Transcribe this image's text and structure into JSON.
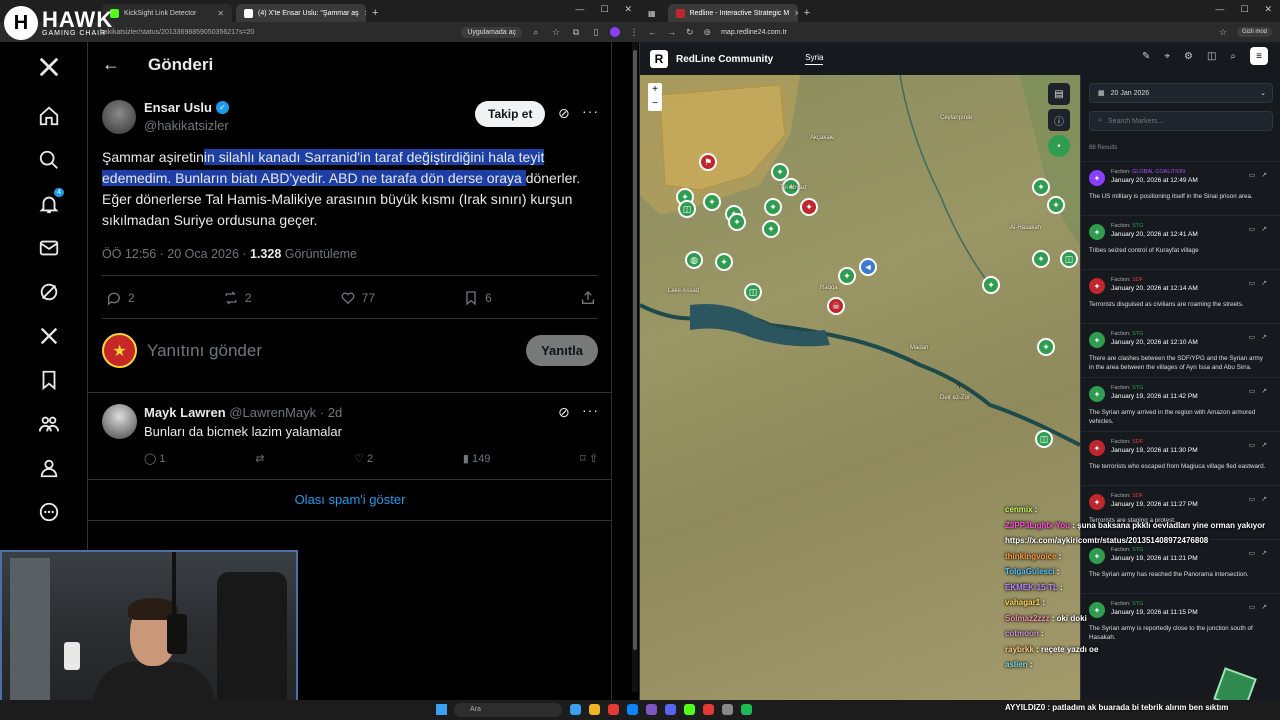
{
  "left_browser": {
    "tabs": [
      {
        "title": "KickSight Link Detector",
        "active": false,
        "color": "#53fc18"
      },
      {
        "title": "(4) X'te Ensar Uslu: \"Şammar aş",
        "active": true,
        "color": "#ffffff"
      }
    ],
    "url": "hakikatsizler/status/20133698859050356217s=20",
    "app_pill": "Uygulamada aç"
  },
  "overlay_logo": {
    "mark": "H",
    "name": "HAWK",
    "sub": "GAMING CHAIR"
  },
  "x_sidebar": {
    "items": [
      "x-logo",
      "home",
      "search",
      "notifications",
      "messages",
      "grok",
      "x-premium",
      "bookmarks",
      "communities",
      "profile",
      "more"
    ],
    "notification_count": "4"
  },
  "x_main": {
    "header": {
      "title": "Gönderi"
    },
    "tweet": {
      "author_name": "Ensar Uslu",
      "author_handle": "@hakikatsizler",
      "follow_label": "Takip et",
      "text_plain_start": "Şammar aşiretin",
      "text_highlighted": "in silahlı kanadı Sarranid'in taraf değiştirdiğini hala teyit edemedim. Bunların biatı ABD'yedir. ABD ne tarafa dön derse oraya ",
      "text_plain_end": "dönerler. Eğer dönerlerse Tal Hamis-Malikiye arasının büyük kısmı (Irak sınırı) kurşun sıkılmadan Suriye ordusuna geçer.",
      "meta_time": "ÖÖ 12:56 · 20 Oca 2026 · ",
      "meta_views": "1.328",
      "meta_views_label": " Görüntüleme",
      "stats": {
        "replies": "2",
        "reposts": "2",
        "likes": "77",
        "bookmarks": "6"
      }
    },
    "reply_placeholder": "Yanıtını gönder",
    "reply_button": "Yanıtla",
    "reply": {
      "name": "Mayk Lawren",
      "handle": "@LawrenMayk · 2d",
      "text": "Bunları da bicmek lazim yalamalar",
      "replies": "1",
      "likes": "2",
      "views": "149"
    },
    "spam_link": "Olası spam'i göster"
  },
  "right_browser": {
    "tab_title": "Redline - Interactive Strategic M",
    "url": "map.redline24.com.tr",
    "incognito": "Gizli mod"
  },
  "redline": {
    "brand": "RedLine Community",
    "region_tab": "Syria",
    "date": "20 Jan 2026",
    "search_placeholder": "Search Markers...",
    "results": "88 Results",
    "feed": [
      {
        "faction": "GLOBAL COALITION",
        "faction_color": "#b04cff",
        "date": "January 20, 2026 at 12:49 AM",
        "text": "The US military is positioning itself in the Sinai prison area.",
        "icon_color": "#8a3ffc"
      },
      {
        "faction": "STG",
        "faction_color": "#2e9d4f",
        "date": "January 20, 2026 at 12:41 AM",
        "text": "Tribes seized control of Kurayfat village",
        "icon_color": "#2e9d4f"
      },
      {
        "faction": "SDF",
        "faction_color": "#e53935",
        "date": "January 20, 2026 at 12:14 AM",
        "text": "Terrorists disguised as civilians are roaming the streets.",
        "icon_color": "#c0262d"
      },
      {
        "faction": "STG",
        "faction_color": "#2e9d4f",
        "date": "January 20, 2026 at 12:10 AM",
        "text": "There are clashes between the SDF/YPG and the Syrian army in the area between the villages of Ayn Issa and Abu Sirra.",
        "icon_color": "#2e9d4f"
      },
      {
        "faction": "STG",
        "faction_color": "#2e9d4f",
        "date": "January 19, 2026 at 11:42 PM",
        "text": "The Syrian army arrived in the region with Amazon armored vehicles.",
        "icon_color": "#2e9d4f"
      },
      {
        "faction": "SDF",
        "faction_color": "#e53935",
        "date": "January 19, 2026 at 11:30 PM",
        "text": "The terrorists who escaped from Magluca village fled eastward.",
        "icon_color": "#c0262d"
      },
      {
        "faction": "SDF",
        "faction_color": "#e53935",
        "date": "January 19, 2026 at 11:27 PM",
        "text": "Terrorists are staging a protest.",
        "icon_color": "#c0262d"
      },
      {
        "faction": "STG",
        "faction_color": "#2e9d4f",
        "date": "January 19, 2026 at 11:21 PM",
        "text": "The Syrian army has reached the Panorama intersection.",
        "icon_color": "#2e9d4f"
      },
      {
        "faction": "STG",
        "faction_color": "#2e9d4f",
        "date": "January 19, 2026 at 11:15 PM",
        "text": "The Syrian army is reportedly close to the junction south of Hasakah.",
        "icon_color": "#2e9d4f"
      }
    ],
    "map_labels": [
      "Akçakale",
      "Ceylanpınar",
      "Tel Abyad",
      "Lake Assad",
      "Raqqa",
      "Deir ez-Zor",
      "Al-Hasakah",
      "Madan"
    ]
  },
  "chat": [
    {
      "user": "cenmix",
      "msg": "",
      "color": "#c7ff5a"
    },
    {
      "user": "Z3PP3Lightx You",
      "msg": "şuna baksana pkklı oevladları yine orman yakıyor",
      "color": "#ff4fd8"
    },
    {
      "user": "",
      "msg": "https://x.com/aykiricomtr/status/20135140897247680​8",
      "color": "#ffffff"
    },
    {
      "user": "thinkingvoice",
      "msg": "",
      "color": "#ff9a3c"
    },
    {
      "user": "TolgaGulesci",
      "msg": "",
      "color": "#4fc3ff"
    },
    {
      "user": "EKMEK-15-TL",
      "msg": "",
      "color": "#b388ff"
    },
    {
      "user": "vahagar1",
      "msg": "",
      "color": "#ffd54f"
    },
    {
      "user": "Solmaz2zzz",
      "msg": "oki doki",
      "color": "#f48fb1"
    },
    {
      "user": "cotmoon",
      "msg": "",
      "color": "#ce93d8"
    },
    {
      "user": "raybrkk",
      "msg": "reçete yazdı oe",
      "color": "#ffcc80"
    },
    {
      "user": "aslien",
      "msg": "",
      "color": "#80deea"
    }
  ],
  "taskbar": {
    "search_placeholder": "Ara",
    "ticker": "AYYILDIZ0 : patladım ak buarada bi tebrik alırım ben sıktım"
  }
}
